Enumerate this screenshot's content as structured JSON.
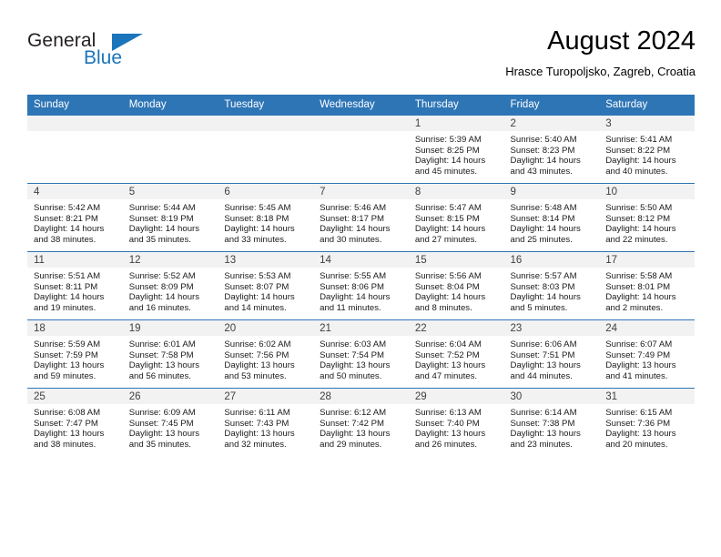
{
  "logo": {
    "word_top": "General",
    "word_bottom": "Blue",
    "accent_color": "#1b75bb",
    "triangle_icon": "triangle-icon"
  },
  "header": {
    "title": "August 2024",
    "subtitle": "Hrasce Turopoljsko, Zagreb, Croatia"
  },
  "theme": {
    "header_bg": "#2e75b6",
    "daynum_bg": "#f2f2f2",
    "text": "#000000"
  },
  "calendar": {
    "weekday_headers": [
      "Sunday",
      "Monday",
      "Tuesday",
      "Wednesday",
      "Thursday",
      "Friday",
      "Saturday"
    ],
    "weeks": [
      [
        {
          "day": "",
          "empty": true
        },
        {
          "day": "",
          "empty": true
        },
        {
          "day": "",
          "empty": true
        },
        {
          "day": "",
          "empty": true
        },
        {
          "day": "1",
          "sunrise": "Sunrise: 5:39 AM",
          "sunset": "Sunset: 8:25 PM",
          "daylight_line1": "Daylight: 14 hours",
          "daylight_line2": "and 45 minutes."
        },
        {
          "day": "2",
          "sunrise": "Sunrise: 5:40 AM",
          "sunset": "Sunset: 8:23 PM",
          "daylight_line1": "Daylight: 14 hours",
          "daylight_line2": "and 43 minutes."
        },
        {
          "day": "3",
          "sunrise": "Sunrise: 5:41 AM",
          "sunset": "Sunset: 8:22 PM",
          "daylight_line1": "Daylight: 14 hours",
          "daylight_line2": "and 40 minutes."
        }
      ],
      [
        {
          "day": "4",
          "sunrise": "Sunrise: 5:42 AM",
          "sunset": "Sunset: 8:21 PM",
          "daylight_line1": "Daylight: 14 hours",
          "daylight_line2": "and 38 minutes."
        },
        {
          "day": "5",
          "sunrise": "Sunrise: 5:44 AM",
          "sunset": "Sunset: 8:19 PM",
          "daylight_line1": "Daylight: 14 hours",
          "daylight_line2": "and 35 minutes."
        },
        {
          "day": "6",
          "sunrise": "Sunrise: 5:45 AM",
          "sunset": "Sunset: 8:18 PM",
          "daylight_line1": "Daylight: 14 hours",
          "daylight_line2": "and 33 minutes."
        },
        {
          "day": "7",
          "sunrise": "Sunrise: 5:46 AM",
          "sunset": "Sunset: 8:17 PM",
          "daylight_line1": "Daylight: 14 hours",
          "daylight_line2": "and 30 minutes."
        },
        {
          "day": "8",
          "sunrise": "Sunrise: 5:47 AM",
          "sunset": "Sunset: 8:15 PM",
          "daylight_line1": "Daylight: 14 hours",
          "daylight_line2": "and 27 minutes."
        },
        {
          "day": "9",
          "sunrise": "Sunrise: 5:48 AM",
          "sunset": "Sunset: 8:14 PM",
          "daylight_line1": "Daylight: 14 hours",
          "daylight_line2": "and 25 minutes."
        },
        {
          "day": "10",
          "sunrise": "Sunrise: 5:50 AM",
          "sunset": "Sunset: 8:12 PM",
          "daylight_line1": "Daylight: 14 hours",
          "daylight_line2": "and 22 minutes."
        }
      ],
      [
        {
          "day": "11",
          "sunrise": "Sunrise: 5:51 AM",
          "sunset": "Sunset: 8:11 PM",
          "daylight_line1": "Daylight: 14 hours",
          "daylight_line2": "and 19 minutes."
        },
        {
          "day": "12",
          "sunrise": "Sunrise: 5:52 AM",
          "sunset": "Sunset: 8:09 PM",
          "daylight_line1": "Daylight: 14 hours",
          "daylight_line2": "and 16 minutes."
        },
        {
          "day": "13",
          "sunrise": "Sunrise: 5:53 AM",
          "sunset": "Sunset: 8:07 PM",
          "daylight_line1": "Daylight: 14 hours",
          "daylight_line2": "and 14 minutes."
        },
        {
          "day": "14",
          "sunrise": "Sunrise: 5:55 AM",
          "sunset": "Sunset: 8:06 PM",
          "daylight_line1": "Daylight: 14 hours",
          "daylight_line2": "and 11 minutes."
        },
        {
          "day": "15",
          "sunrise": "Sunrise: 5:56 AM",
          "sunset": "Sunset: 8:04 PM",
          "daylight_line1": "Daylight: 14 hours",
          "daylight_line2": "and 8 minutes."
        },
        {
          "day": "16",
          "sunrise": "Sunrise: 5:57 AM",
          "sunset": "Sunset: 8:03 PM",
          "daylight_line1": "Daylight: 14 hours",
          "daylight_line2": "and 5 minutes."
        },
        {
          "day": "17",
          "sunrise": "Sunrise: 5:58 AM",
          "sunset": "Sunset: 8:01 PM",
          "daylight_line1": "Daylight: 14 hours",
          "daylight_line2": "and 2 minutes."
        }
      ],
      [
        {
          "day": "18",
          "sunrise": "Sunrise: 5:59 AM",
          "sunset": "Sunset: 7:59 PM",
          "daylight_line1": "Daylight: 13 hours",
          "daylight_line2": "and 59 minutes."
        },
        {
          "day": "19",
          "sunrise": "Sunrise: 6:01 AM",
          "sunset": "Sunset: 7:58 PM",
          "daylight_line1": "Daylight: 13 hours",
          "daylight_line2": "and 56 minutes."
        },
        {
          "day": "20",
          "sunrise": "Sunrise: 6:02 AM",
          "sunset": "Sunset: 7:56 PM",
          "daylight_line1": "Daylight: 13 hours",
          "daylight_line2": "and 53 minutes."
        },
        {
          "day": "21",
          "sunrise": "Sunrise: 6:03 AM",
          "sunset": "Sunset: 7:54 PM",
          "daylight_line1": "Daylight: 13 hours",
          "daylight_line2": "and 50 minutes."
        },
        {
          "day": "22",
          "sunrise": "Sunrise: 6:04 AM",
          "sunset": "Sunset: 7:52 PM",
          "daylight_line1": "Daylight: 13 hours",
          "daylight_line2": "and 47 minutes."
        },
        {
          "day": "23",
          "sunrise": "Sunrise: 6:06 AM",
          "sunset": "Sunset: 7:51 PM",
          "daylight_line1": "Daylight: 13 hours",
          "daylight_line2": "and 44 minutes."
        },
        {
          "day": "24",
          "sunrise": "Sunrise: 6:07 AM",
          "sunset": "Sunset: 7:49 PM",
          "daylight_line1": "Daylight: 13 hours",
          "daylight_line2": "and 41 minutes."
        }
      ],
      [
        {
          "day": "25",
          "sunrise": "Sunrise: 6:08 AM",
          "sunset": "Sunset: 7:47 PM",
          "daylight_line1": "Daylight: 13 hours",
          "daylight_line2": "and 38 minutes."
        },
        {
          "day": "26",
          "sunrise": "Sunrise: 6:09 AM",
          "sunset": "Sunset: 7:45 PM",
          "daylight_line1": "Daylight: 13 hours",
          "daylight_line2": "and 35 minutes."
        },
        {
          "day": "27",
          "sunrise": "Sunrise: 6:11 AM",
          "sunset": "Sunset: 7:43 PM",
          "daylight_line1": "Daylight: 13 hours",
          "daylight_line2": "and 32 minutes."
        },
        {
          "day": "28",
          "sunrise": "Sunrise: 6:12 AM",
          "sunset": "Sunset: 7:42 PM",
          "daylight_line1": "Daylight: 13 hours",
          "daylight_line2": "and 29 minutes."
        },
        {
          "day": "29",
          "sunrise": "Sunrise: 6:13 AM",
          "sunset": "Sunset: 7:40 PM",
          "daylight_line1": "Daylight: 13 hours",
          "daylight_line2": "and 26 minutes."
        },
        {
          "day": "30",
          "sunrise": "Sunrise: 6:14 AM",
          "sunset": "Sunset: 7:38 PM",
          "daylight_line1": "Daylight: 13 hours",
          "daylight_line2": "and 23 minutes."
        },
        {
          "day": "31",
          "sunrise": "Sunrise: 6:15 AM",
          "sunset": "Sunset: 7:36 PM",
          "daylight_line1": "Daylight: 13 hours",
          "daylight_line2": "and 20 minutes."
        }
      ]
    ]
  }
}
